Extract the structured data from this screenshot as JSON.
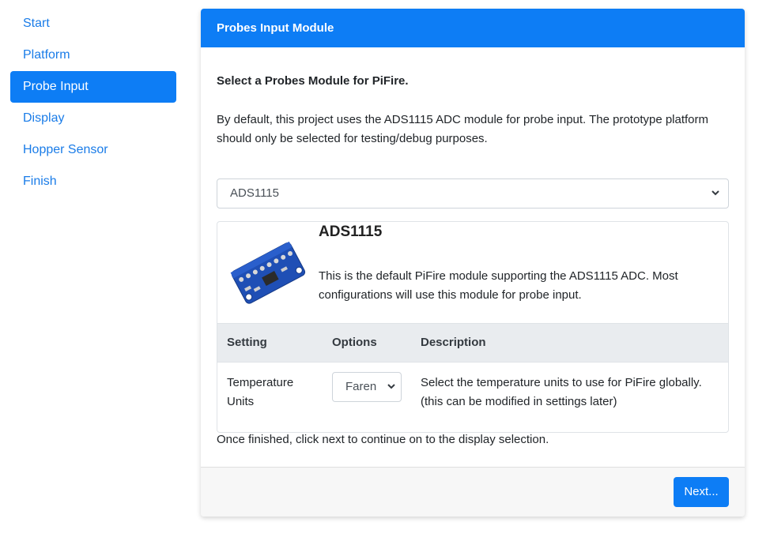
{
  "sidebar": {
    "items": [
      {
        "label": "Start"
      },
      {
        "label": "Platform"
      },
      {
        "label": "Probe Input"
      },
      {
        "label": "Display"
      },
      {
        "label": "Hopper Sensor"
      },
      {
        "label": "Finish"
      }
    ],
    "active_index": 2
  },
  "card": {
    "header": "Probes Input Module",
    "lead_title": "Select a Probes Module for PiFire.",
    "intro": "By default, this project uses the ADS1115 ADC module for probe input. The prototype platform should only be selected for testing/debug purposes.",
    "module_select_value": "ADS1115",
    "module": {
      "title": "ADS1115",
      "description": "This is the default PiFire module supporting the ADS1115 ADC. Most configurations will use this module for probe input."
    },
    "table": {
      "headers": [
        "Setting",
        "Options",
        "Description"
      ],
      "rows": [
        {
          "setting": "Temperature Units",
          "option_value": "Faren",
          "description": "Select the temperature units to use for PiFire globally. (this can be modified in settings later)"
        }
      ]
    },
    "finish_text": "Once finished, click next to continue on to the display selection.",
    "next_label": "Next..."
  },
  "colors": {
    "accent": "#0d7df5",
    "link": "#1a7ce8",
    "table_header_bg": "#e9ecef",
    "footer_bg": "#f7f7f7"
  },
  "icons": {
    "select_arrow": "chevron-down-icon",
    "module_image": "ads1115-board-image"
  }
}
